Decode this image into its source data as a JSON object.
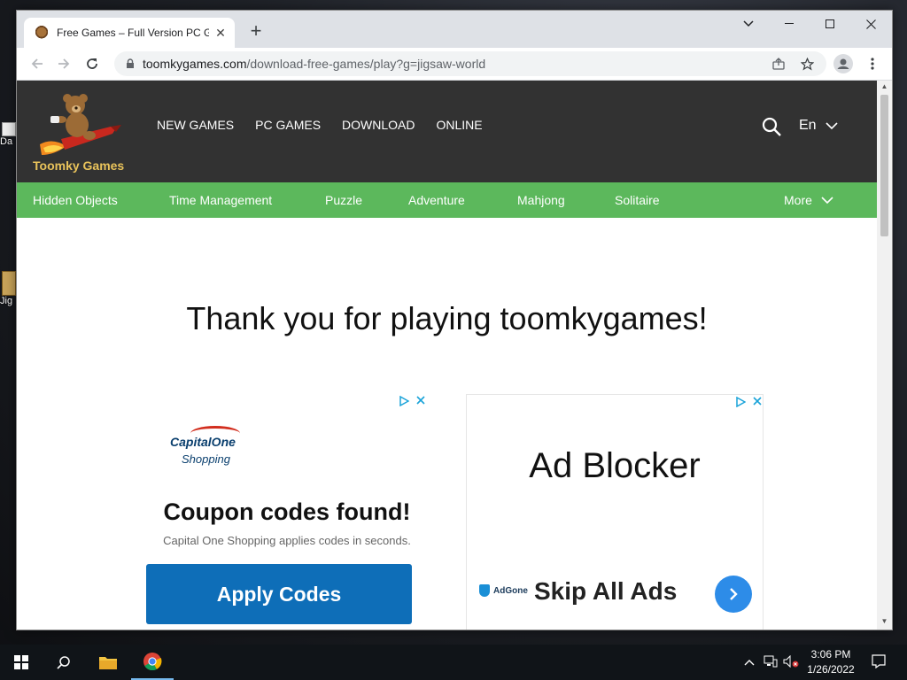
{
  "desktop": {
    "icons": [
      {
        "label": "Da"
      },
      {
        "label": "Jig"
      }
    ]
  },
  "browser": {
    "tab": {
      "title": "Free Games – Full Version PC Ga",
      "close": "✕"
    },
    "new_tab": "+",
    "url": {
      "host": "toomkygames.com",
      "path": "/download-free-games/play?g=jigsaw-world"
    }
  },
  "site": {
    "logo_text": "Toomky Games",
    "nav": [
      "NEW GAMES",
      "PC GAMES",
      "DOWNLOAD",
      "ONLINE"
    ],
    "language": "En",
    "categories": [
      "Hidden Objects",
      "Time Management",
      "Puzzle",
      "Adventure",
      "Mahjong",
      "Solitaire"
    ],
    "more": "More",
    "thanks": "Thank you for playing toomkygames!"
  },
  "ads": {
    "left": {
      "brand_name": "CapitalOne",
      "brand_sub": "Shopping",
      "title": "Coupon codes found!",
      "subtitle": "Capital One Shopping applies codes in seconds.",
      "button": "Apply Codes"
    },
    "right": {
      "title": "Ad Blocker",
      "brand": "AdGone",
      "cta": "Skip All Ads"
    }
  },
  "taskbar": {
    "time": "3:06 PM",
    "date": "1/26/2022"
  },
  "colors": {
    "header_bg": "#323232",
    "category_bar": "#5cb85c",
    "logo_text": "#e9c35b",
    "apply_button": "#0e6eb8"
  }
}
